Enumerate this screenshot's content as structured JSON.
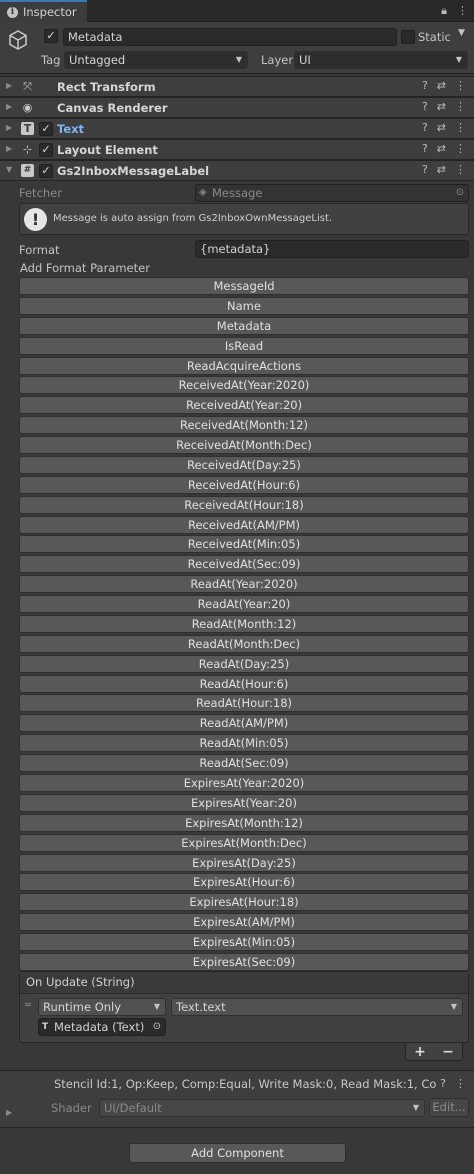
{
  "tab": {
    "title": "Inspector"
  },
  "gameobject": {
    "name": "Metadata",
    "static_label": "Static",
    "tag_label": "Tag",
    "tag_value": "Untagged",
    "layer_label": "Layer",
    "layer_value": "UI"
  },
  "components": [
    {
      "name": "Rect Transform",
      "icon": "rect-transform-icon"
    },
    {
      "name": "Canvas Renderer",
      "icon": "eye-icon"
    },
    {
      "name": "Text",
      "icon": "text-icon"
    },
    {
      "name": "Layout Element",
      "icon": "layout-element-icon"
    },
    {
      "name": "Gs2InboxMessageLabel",
      "icon": "script-icon"
    }
  ],
  "label_component": {
    "fetcher_label": "Fetcher",
    "fetcher_value": "Message",
    "help_message": "Message is auto assign from Gs2InboxOwnMessageList.",
    "format_label": "Format",
    "format_value": "{metadata}",
    "add_param_label": "Add Format Parameter",
    "params": [
      "MessageId",
      "Name",
      "Metadata",
      "IsRead",
      "ReadAcquireActions",
      "ReceivedAt(Year:2020)",
      "ReceivedAt(Year:20)",
      "ReceivedAt(Month:12)",
      "ReceivedAt(Month:Dec)",
      "ReceivedAt(Day:25)",
      "ReceivedAt(Hour:6)",
      "ReceivedAt(Hour:18)",
      "ReceivedAt(AM/PM)",
      "ReceivedAt(Min:05)",
      "ReceivedAt(Sec:09)",
      "ReadAt(Year:2020)",
      "ReadAt(Year:20)",
      "ReadAt(Month:12)",
      "ReadAt(Month:Dec)",
      "ReadAt(Day:25)",
      "ReadAt(Hour:6)",
      "ReadAt(Hour:18)",
      "ReadAt(AM/PM)",
      "ReadAt(Min:05)",
      "ReadAt(Sec:09)",
      "ExpiresAt(Year:2020)",
      "ExpiresAt(Year:20)",
      "ExpiresAt(Month:12)",
      "ExpiresAt(Month:Dec)",
      "ExpiresAt(Day:25)",
      "ExpiresAt(Hour:6)",
      "ExpiresAt(Hour:18)",
      "ExpiresAt(AM/PM)",
      "ExpiresAt(Min:05)",
      "ExpiresAt(Sec:09)"
    ],
    "event": {
      "title": "On Update (String)",
      "mode": "Runtime Only",
      "function": "Text.text",
      "target": "Metadata (Text)",
      "add": "+",
      "remove": "−"
    }
  },
  "material": {
    "stencil_info": "Stencil Id:1, Op:Keep, Comp:Equal, Write Mask:0, Read Mask:1, Co",
    "shader_label": "Shader",
    "shader_value": "UI/Default",
    "edit_label": "Edit..."
  },
  "add_component_label": "Add Component",
  "colors": {
    "accent": "#3a79bb",
    "background": "#383838",
    "button": "#585858",
    "text_link": "#7eb4f5"
  }
}
